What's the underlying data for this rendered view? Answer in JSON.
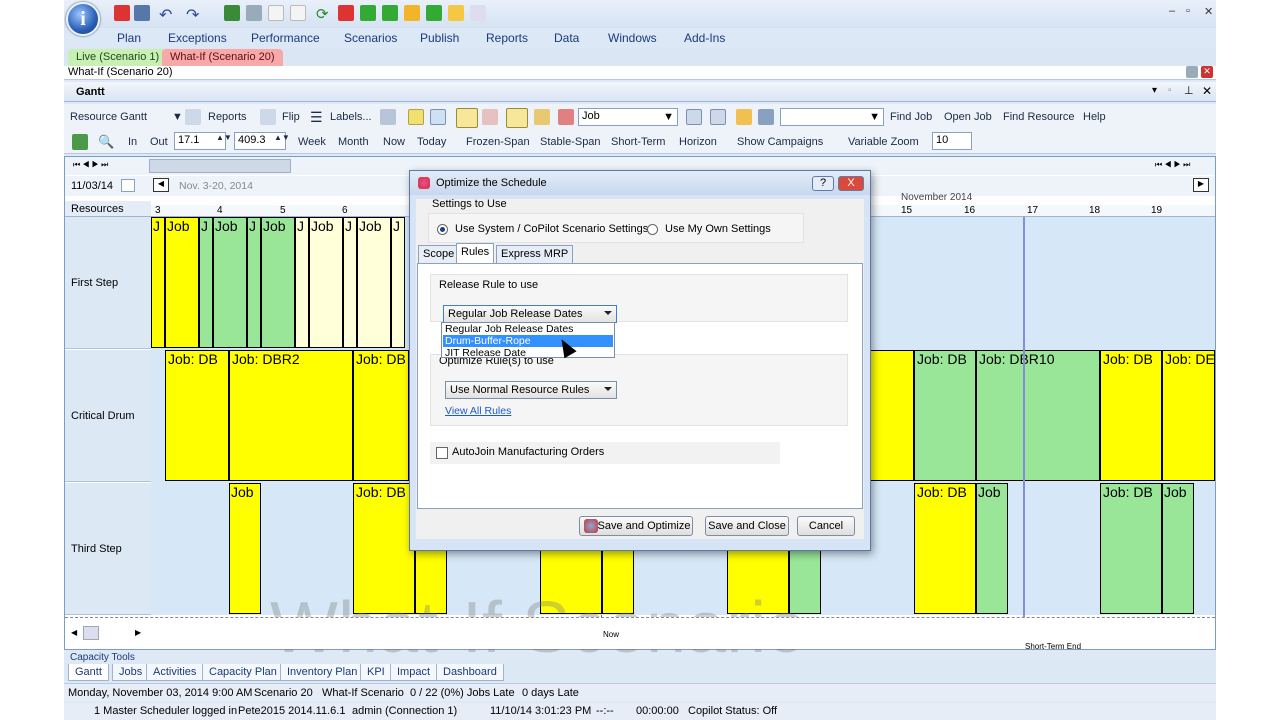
{
  "menu": [
    "Plan",
    "Exceptions",
    "Performance",
    "Scenarios",
    "Publish",
    "Reports",
    "Data",
    "Windows",
    "Add-Ins"
  ],
  "scenario_tabs": {
    "live": "Live (Scenario 1)",
    "whatif": "What-If (Scenario 20)"
  },
  "doc_title": "What-If (Scenario 20)",
  "panel_title": "Gantt",
  "toolbar1": {
    "view_select": "Resource Gantt",
    "reports": "Reports",
    "flip": "Flip",
    "labels": "Labels...",
    "job_select": "Job",
    "find_job": "Find Job",
    "open_job": "Open Job",
    "find_resource": "Find Resource",
    "help": "Help"
  },
  "toolbar2": {
    "in": "In",
    "out": "Out",
    "zoom_in_value": "17.1",
    "zoom_out_value": "409.3",
    "week": "Week",
    "month": "Month",
    "now": "Now",
    "today": "Today",
    "frozen_span": "Frozen-Span",
    "stable_span": "Stable-Span",
    "short_term": "Short-Term",
    "horizon": "Horizon",
    "show_campaigns": "Show Campaigns",
    "variable_zoom": "Variable Zoom",
    "variable_zoom_value": "10"
  },
  "gantt": {
    "date_field": "11/03/14",
    "date_range": "Nov. 3-20, 2014",
    "resources_header": "Resources",
    "month_header": "November 2014",
    "days": [
      "3",
      "4",
      "5",
      "6",
      "15",
      "16",
      "17",
      "18",
      "19"
    ],
    "resources": [
      "First Step",
      "Critical Drum",
      "Third Step"
    ],
    "bar_labels": {
      "j": "J",
      "job": "Job",
      "job_db": "Job: DB",
      "job_dbr2": "Job: DBR2",
      "job_dbr10": "Job: DBR10",
      "job_db_cut": "Job: DE"
    },
    "markers": {
      "now": "Now",
      "short_term_end": "Short-Term End"
    },
    "watermark": "What-If Scenario"
  },
  "dialog": {
    "title": "Optimize the Schedule",
    "settings_label": "Settings to Use",
    "radio_system": "Use System / CoPilot Scenario Settings",
    "radio_own": "Use My Own Settings",
    "tabs": [
      "Scope",
      "Rules",
      "Express MRP"
    ],
    "active_tab": "Rules",
    "release_rule_label": "Release Rule to use",
    "release_rule_value": "Regular Job Release Dates",
    "release_options": [
      "Regular Job Release Dates",
      "Drum-Buffer-Rope",
      "JIT Release Date"
    ],
    "selected_option": "Drum-Buffer-Rope",
    "optimize_rules_label": "Optimize Rule(s) to use",
    "resource_rules_value": "Use Normal Resource Rules",
    "view_all_rules": "View All Rules",
    "autojoin": "AutoJoin Manufacturing Orders",
    "buttons": {
      "save_optimize": "Save and Optimize",
      "save_close": "Save and Close",
      "cancel": "Cancel"
    },
    "help": "?",
    "close": "X"
  },
  "capacity_tools": "Capacity Tools",
  "bottom_tabs": [
    "Gantt",
    "Jobs",
    "Activities",
    "Capacity Plan",
    "Inventory Plan",
    "KPI",
    "Impact",
    "Dashboard"
  ],
  "status1": {
    "datetime": "Monday, November 03, 2014 9:00 AM",
    "scenario": "Scenario 20",
    "type": "What-If Scenario",
    "late": "0 / 22  (0%) Jobs Late",
    "days_late": "0 days Late"
  },
  "status2": {
    "logged": "1 Master Scheduler logged in",
    "server": "Pete2015 2014.11.6.1",
    "user": "admin (Connection 1)",
    "time": "11/10/14 3:01:23 PM",
    "dashes": "--:--",
    "timer": "00:00:00",
    "copilot": "Copilot Status: Off"
  },
  "colors": {
    "job_yellow": "#ffff00",
    "job_green": "#99e699",
    "job_pale": "#ffffd9",
    "bg_blue": "#d6e8f8",
    "accent": "#1a3a7a"
  }
}
